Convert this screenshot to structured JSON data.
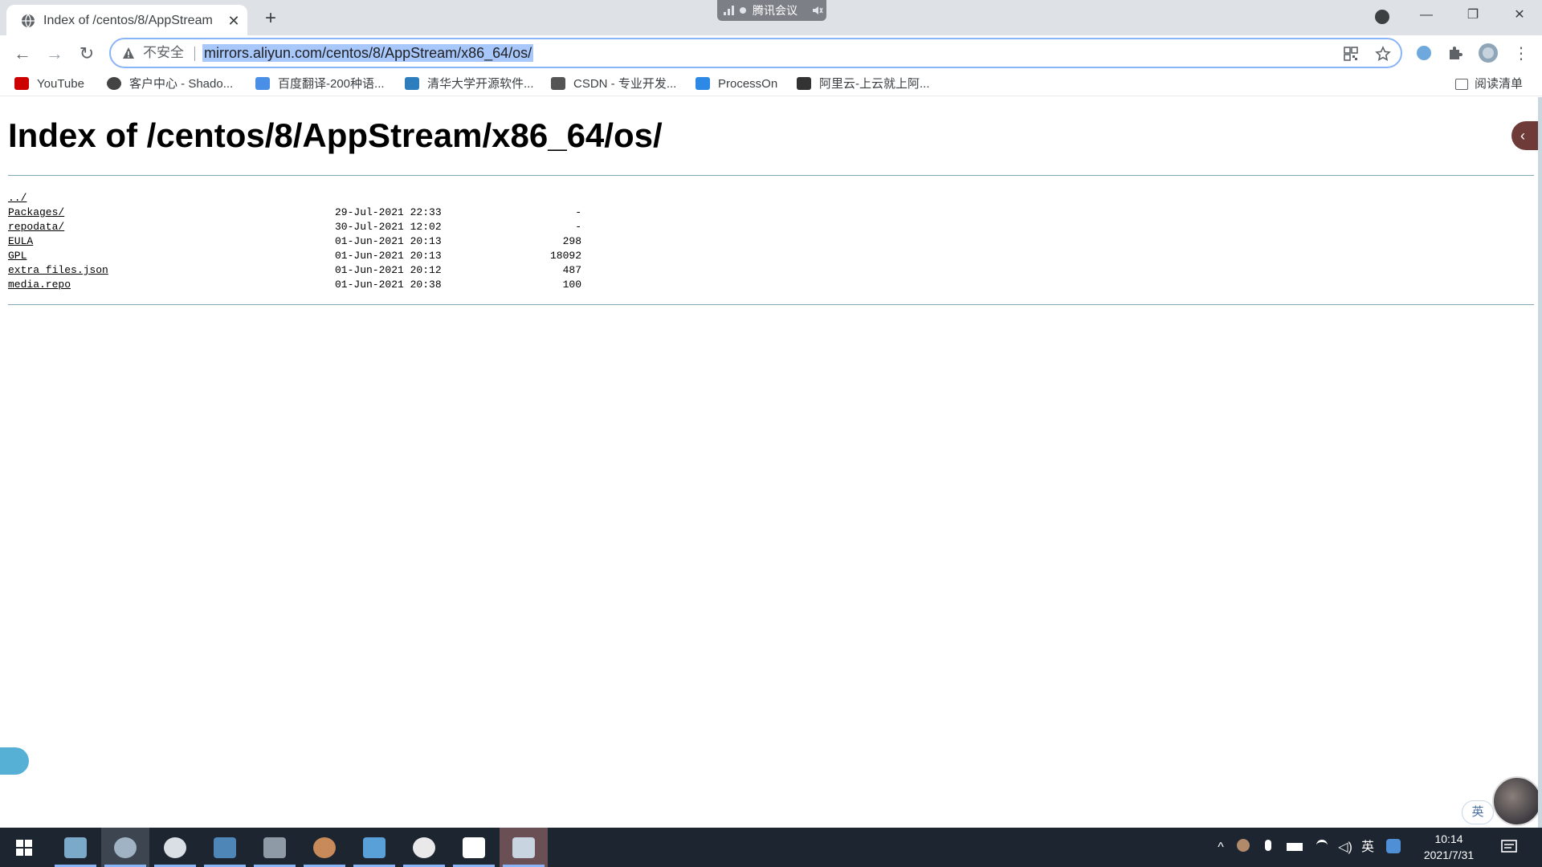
{
  "browser": {
    "tab_title": "Index of /centos/8/AppStream",
    "tab_close": "✕",
    "new_tab": "+",
    "meeting_label": "腾讯会议",
    "url": "mirrors.aliyun.com/centos/8/AppStream/x86_64/os/",
    "security_label": "不安全",
    "window_controls": {
      "minimize": "—",
      "maximize": "❐",
      "close": "✕"
    },
    "nav": {
      "back": "←",
      "forward": "→",
      "reload": "↻"
    },
    "menu": "⋮",
    "icons": [
      "globe-icon",
      "warning-icon",
      "qr-icon",
      "star-icon",
      "extension-icon",
      "puzzle-icon",
      "profile-icon"
    ]
  },
  "bookmarks": [
    {
      "label": "YouTube",
      "icon": "youtube-icon",
      "color": "#cc0000"
    },
    {
      "label": "客户中心 - Shado...",
      "icon": "shadow-icon",
      "color": "#444444"
    },
    {
      "label": "百度翻译-200种语...",
      "icon": "baidu-translate-icon",
      "color": "#4a8fe7"
    },
    {
      "label": "清华大学开源软件...",
      "icon": "tsinghua-icon",
      "color": "#2e7dbd"
    },
    {
      "label": "CSDN - 专业开发...",
      "icon": "csdn-icon",
      "color": "#555555"
    },
    {
      "label": "ProcessOn",
      "icon": "processon-icon",
      "color": "#2d89e5"
    },
    {
      "label": "阿里云-上云就上阿...",
      "icon": "aliyun-icon",
      "color": "#333333"
    }
  ],
  "reading_list": "阅读清单",
  "page": {
    "title": "Index of /centos/8/AppStream/x86_64/os/",
    "entries": [
      {
        "name": "../",
        "date": "",
        "size": ""
      },
      {
        "name": "Packages/",
        "date": "29-Jul-2021 22:33",
        "size": "-"
      },
      {
        "name": "repodata/",
        "date": "30-Jul-2021 12:02",
        "size": "-"
      },
      {
        "name": "EULA",
        "date": "01-Jun-2021 20:13",
        "size": "298"
      },
      {
        "name": "GPL",
        "date": "01-Jun-2021 20:13",
        "size": "18092"
      },
      {
        "name": "extra_files.json",
        "date": "01-Jun-2021 20:12",
        "size": "487"
      },
      {
        "name": "media.repo",
        "date": "01-Jun-2021 20:38",
        "size": "100"
      }
    ],
    "side_handle": "‹",
    "ime": "英"
  },
  "taskbar": {
    "apps": [
      "windows-start",
      "image-app",
      "chrome",
      "wechat",
      "vm-app",
      "storage-app",
      "snail-app",
      "photos-app",
      "netease-music",
      "typora",
      "remote-app"
    ],
    "tray_language": "英",
    "time": "10:14",
    "date": "2021/7/31"
  },
  "colors": {
    "accent": "#8ab4f8",
    "url_highlight": "#a8c7fa",
    "rule": "#7fa8b4",
    "taskbar": "#1c2530"
  }
}
